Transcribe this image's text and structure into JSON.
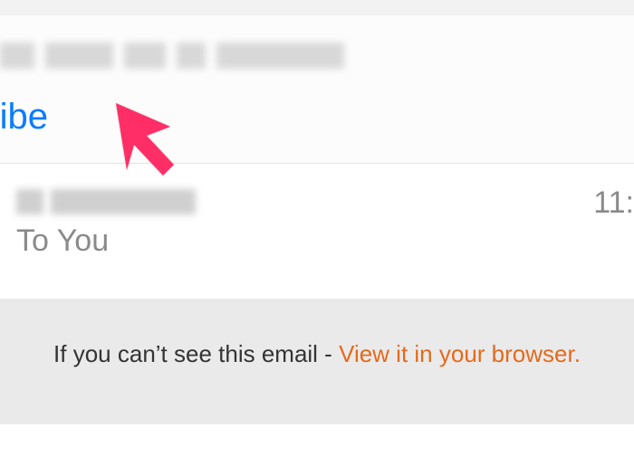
{
  "header": {
    "unsubscribe_label": "bscribe"
  },
  "meta": {
    "to_line": "To You",
    "timestamp": "11:"
  },
  "banner": {
    "text": "If you can’t see this email - ",
    "link_label": "View it in your browser."
  },
  "colors": {
    "link_blue": "#0a7cff",
    "link_orange": "#e56a1c",
    "arrow": "#ff2d66"
  },
  "annotation": {
    "arrow_name": "pointer-arrow"
  }
}
